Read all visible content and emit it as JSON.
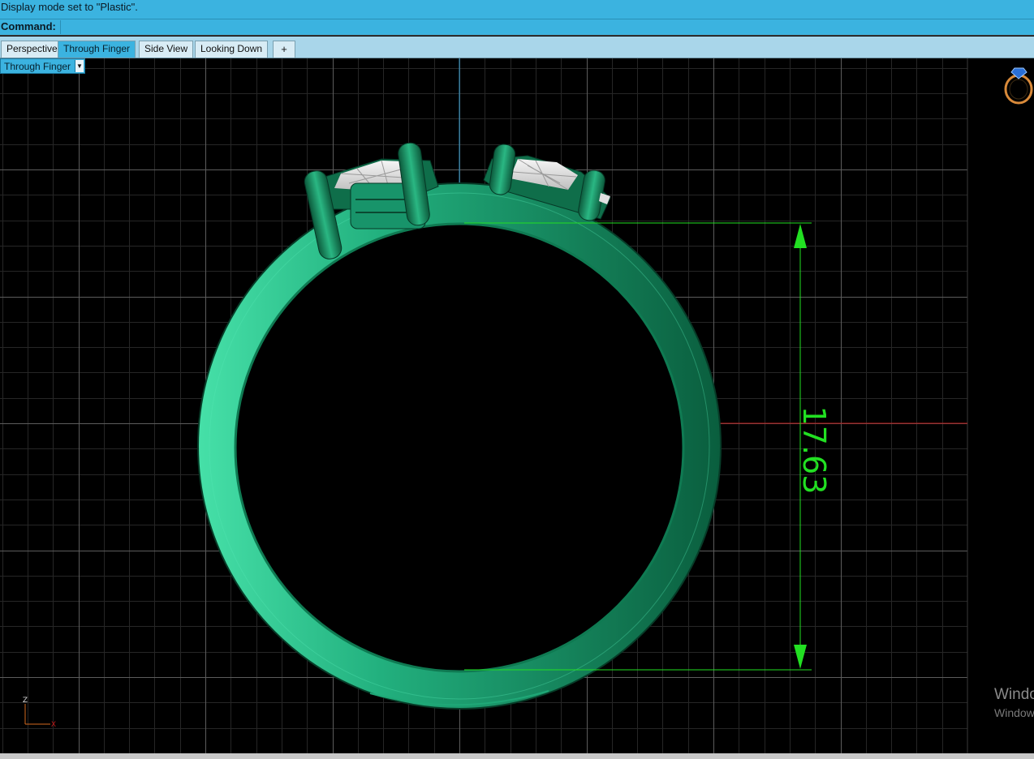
{
  "history": {
    "text": "Display mode set to \"Plastic\"."
  },
  "command": {
    "label": "Command:",
    "value": ""
  },
  "tabs": [
    {
      "label": "Perspective",
      "active": false
    },
    {
      "label": "Through Finger",
      "active": true
    },
    {
      "label": "Side View",
      "active": false
    },
    {
      "label": "Looking Down",
      "active": false
    },
    {
      "label": "+",
      "icon": "add-tab-icon"
    }
  ],
  "viewport": {
    "label": "Through Finger",
    "dropdown_icon": "chevron-down-icon",
    "dimension_text": "17.63",
    "axis_labels": {
      "vertical": "Z",
      "horizontal": "X"
    },
    "nav_icon": "ring-navigator-icon",
    "colors": {
      "ring": "#1fa877",
      "ring_dark": "#0c5a3c",
      "dimension": "#22e022",
      "x_axis": "#c01818",
      "z_axis": "#2a93c9",
      "grid_minor": "#2b2b2b",
      "grid_major": "#5a5a5a"
    }
  },
  "watermark": {
    "line1": "Windo",
    "line2": "Window"
  }
}
